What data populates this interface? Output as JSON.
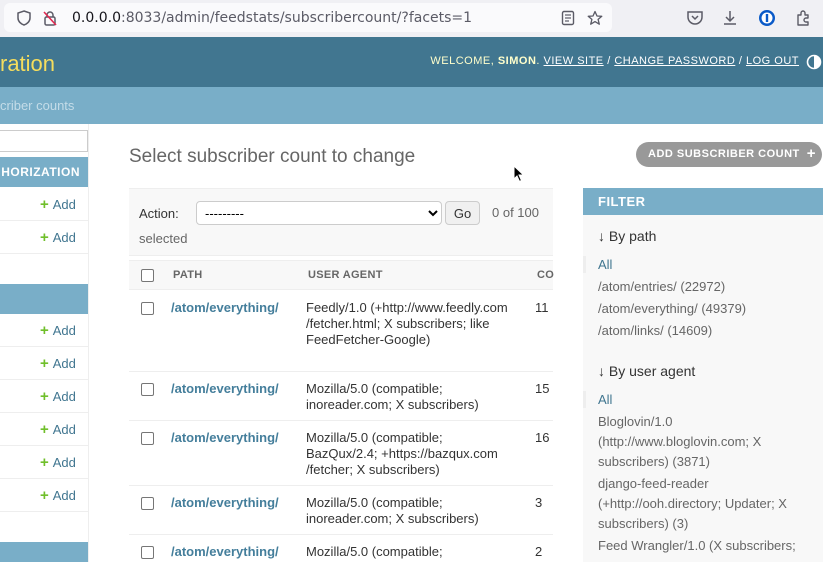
{
  "browser": {
    "url_host": "0.0.0.0",
    "url_rest": ":8033/admin/feedstats/subscribercount/?facets=1"
  },
  "header": {
    "branding": "ration",
    "welcome": "WELCOME, ",
    "user": "SIMON",
    "view_site": "VIEW SITE",
    "change_password": "CHANGE PASSWORD",
    "log_out": "LOG OUT"
  },
  "breadcrumbs": "criber counts",
  "sidebar": {
    "captions": [
      "HORIZATION"
    ],
    "add_label": "Add"
  },
  "content": {
    "title": "Select subscriber count to change",
    "add_button": "ADD SUBSCRIBER COUNT",
    "action_label": "Action:",
    "action_option": "---------",
    "go_label": "Go",
    "counter": "0 of 100",
    "selected": "selected",
    "columns": [
      "PATH",
      "USER AGENT",
      "CO"
    ],
    "rows": [
      {
        "path": "/atom/everything/",
        "ua": "Feedly/1.0 (+http://www.feedly.com /fetcher.html; X subscribers; like FeedFetcher-Google)",
        "count": "11"
      },
      {
        "path": "/atom/everything/",
        "ua": "Mozilla/5.0 (compatible; inoreader.com; X subscribers)",
        "count": "15"
      },
      {
        "path": "/atom/everything/",
        "ua": "Mozilla/5.0 (compatible; BazQux/2.4; +https://bazqux.com /fetcher; X subscribers)",
        "count": "16"
      },
      {
        "path": "/atom/everything/",
        "ua": "Mozilla/5.0 (compatible; inoreader.com; X subscribers)",
        "count": "3"
      },
      {
        "path": "/atom/everything/",
        "ua": "Mozilla/5.0 (compatible;",
        "count": "2"
      }
    ]
  },
  "filter": {
    "title": "FILTER",
    "by_path": "By path",
    "path_items": [
      "All",
      "/atom/entries/ (22972)",
      "/atom/everything/ (49379)",
      "/atom/links/ (14609)"
    ],
    "by_ua": "By user agent",
    "ua_items": [
      "All",
      "Bloglovin/1.0 (http://www.bloglovin.com; X subscribers) (3871)",
      "django-feed-reader (+http://ooh.directory; Updater; X subscribers) (3)",
      "Feed Wrangler/1.0 (X subscribers;"
    ]
  },
  "colors": {
    "header": "#417690",
    "breadcrumbs": "#79aec8",
    "branding": "#f5dd5d",
    "link": "#447e9b",
    "add_plus": "#70bf2b"
  }
}
